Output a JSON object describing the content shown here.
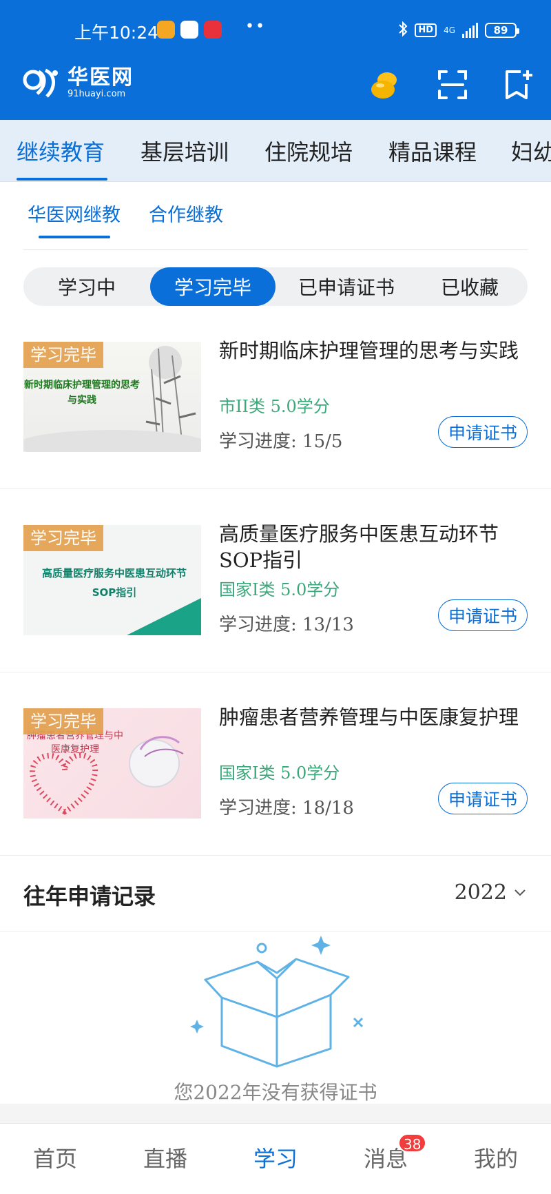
{
  "status_bar": {
    "time": "上午10:24",
    "hd": "HD",
    "network": "4G",
    "battery": "89"
  },
  "header": {
    "logo_cn": "华医网",
    "logo_en": "91huayi.com"
  },
  "categories": [
    "继续教育",
    "基层培训",
    "住院规培",
    "精品课程",
    "妇幼"
  ],
  "subtabs": [
    "华医网继教",
    "合作继教"
  ],
  "segments": [
    "学习中",
    "学习完毕",
    "已申请证书",
    "已收藏"
  ],
  "courses": [
    {
      "badge": "学习完毕",
      "thumb_text": "新时期临床护理管理的思考与实践",
      "title": "新时期临床护理管理的思考与实践",
      "credit": "市II类  5.0学分",
      "progress": "学习进度: 15/5",
      "action": "申请证书"
    },
    {
      "badge": "学习完毕",
      "thumb_text": "高质量医疗服务中医患互动环节SOP指引",
      "title": "高质量医疗服务中医患互动环节SOP指引",
      "credit": "国家I类  5.0学分",
      "progress": "学习进度: 13/13",
      "action": "申请证书"
    },
    {
      "badge": "学习完毕",
      "thumb_text": "肿瘤患者营养管理与中医康复护理",
      "title": "肿瘤患者营养管理与中医康复护理",
      "credit": "国家I类  5.0学分",
      "progress": "学习进度: 18/18",
      "action": "申请证书"
    }
  ],
  "records": {
    "title": "往年申请记录",
    "year": "2022",
    "empty_message": "您2022年没有获得证书"
  },
  "bottom_nav": {
    "items": [
      "首页",
      "直播",
      "学习",
      "消息",
      "我的"
    ],
    "badge": "38"
  },
  "colors": {
    "primary": "#0a6fd8",
    "credit_green": "#3aa87a",
    "badge_orange": "#e2a050",
    "badge_red": "#f23d3d"
  }
}
